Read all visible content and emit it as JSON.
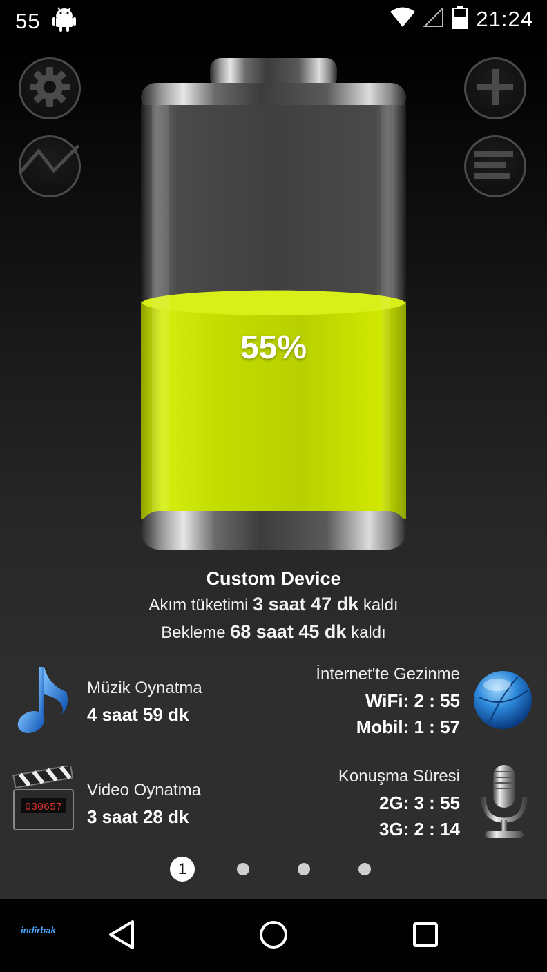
{
  "status_bar": {
    "left_number": "55",
    "time": "21:24"
  },
  "battery": {
    "percent_text": "55%",
    "level": 0.55,
    "fill_color": "#c8e000"
  },
  "device": {
    "name": "Custom Device",
    "usage_prefix": "Akım tüketimi",
    "usage_value": "3 saat 47 dk",
    "usage_suffix": "kaldı",
    "standby_prefix": "Bekleme",
    "standby_value": "68 saat 45 dk",
    "standby_suffix": "kaldı"
  },
  "stats": {
    "music": {
      "label": "Müzik Oynatma",
      "value": "4 saat 59 dk",
      "icon": "music-note-icon"
    },
    "video": {
      "label": "Video Oynatma",
      "value": "3 saat 28 dk",
      "icon": "clapperboard-icon",
      "icon_counter": "030657"
    },
    "internet": {
      "label": "İnternet'te Gezinme",
      "wifi": "WiFi: 2 : 55",
      "mobile": "Mobil: 1 : 57",
      "icon": "globe-icon"
    },
    "talk": {
      "label": "Konuşma Süresi",
      "g2": "2G: 3 : 55",
      "g3": "3G: 2 : 14",
      "icon": "microphone-icon"
    }
  },
  "pager": {
    "active_label": "1",
    "total": 4,
    "active_index": 0
  },
  "watermark": "indirbak"
}
